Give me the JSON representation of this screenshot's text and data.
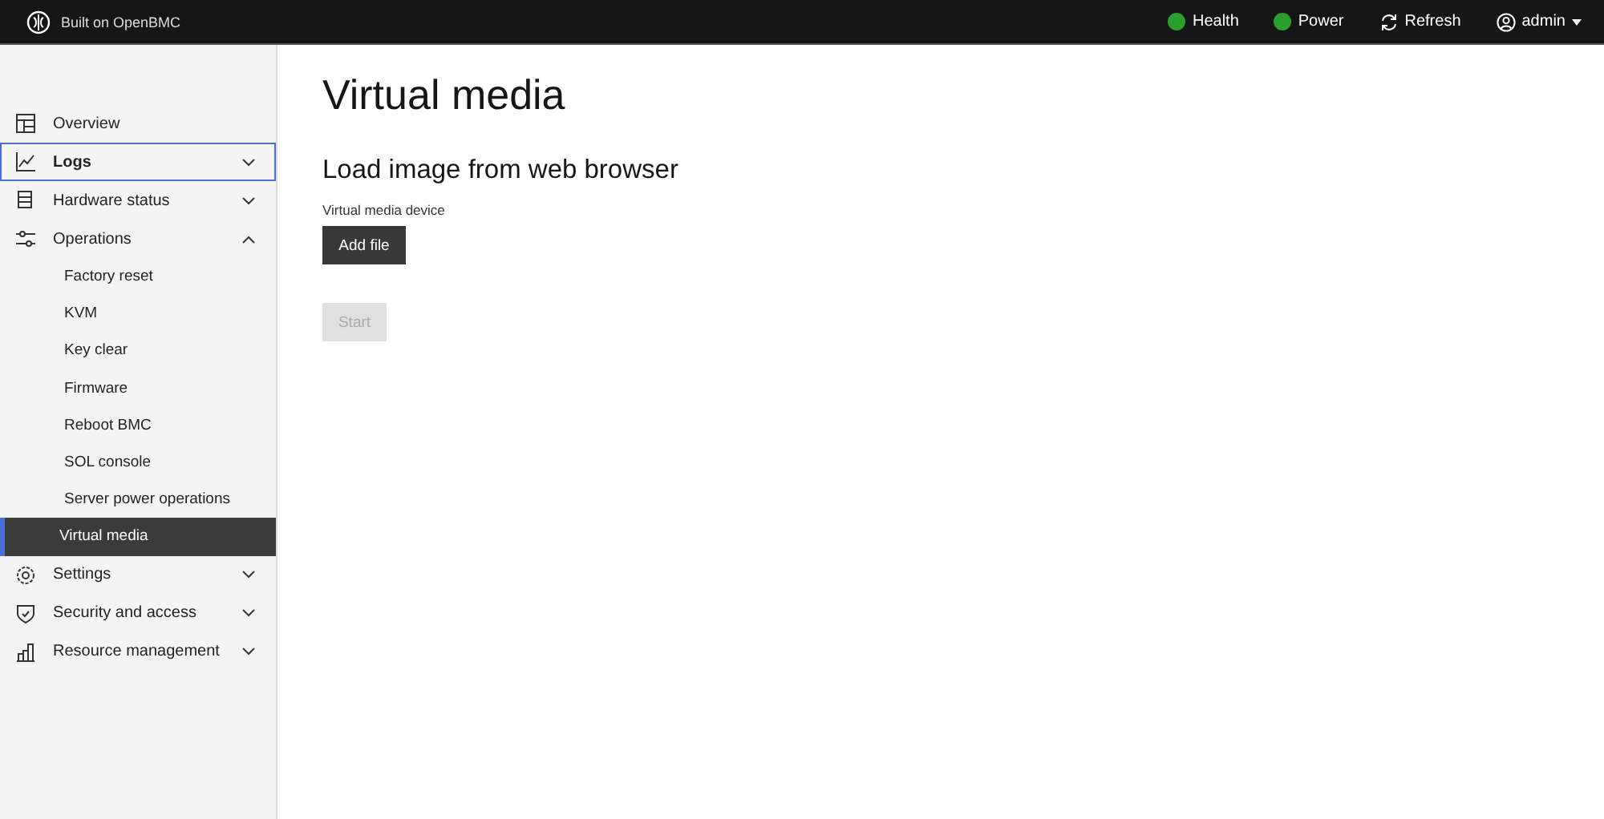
{
  "header": {
    "brand": "Built on OpenBMC",
    "status": [
      {
        "label": "Health",
        "color": "#2ca02c"
      },
      {
        "label": "Power",
        "color": "#2ca02c"
      }
    ],
    "refresh": "Refresh",
    "user": "admin"
  },
  "sidebar": {
    "items": [
      {
        "label": "Overview",
        "focused": false
      },
      {
        "label": "Logs",
        "focused": true,
        "expanded": false
      },
      {
        "label": "Hardware status",
        "focused": false,
        "expanded": false
      },
      {
        "label": "Operations",
        "focused": false,
        "expanded": true,
        "children": [
          {
            "label": "Factory reset",
            "selected": false
          },
          {
            "label": "KVM",
            "selected": false
          },
          {
            "label": "Key clear",
            "selected": false
          },
          {
            "label": "Firmware",
            "selected": false
          },
          {
            "label": "Reboot BMC",
            "selected": false
          },
          {
            "label": "SOL console",
            "selected": false
          },
          {
            "label": "Server power operations",
            "selected": false
          },
          {
            "label": "Virtual media",
            "selected": true
          }
        ]
      },
      {
        "label": "Settings",
        "focused": false,
        "expanded": false
      },
      {
        "label": "Security and access",
        "focused": false,
        "expanded": false
      },
      {
        "label": "Resource management",
        "focused": false,
        "expanded": false
      }
    ]
  },
  "page": {
    "title": "Virtual media",
    "section": "Load image from web browser",
    "device_label": "Virtual media device",
    "add_button": "Add file",
    "start_button": {
      "label": "Start",
      "disabled": true
    }
  }
}
